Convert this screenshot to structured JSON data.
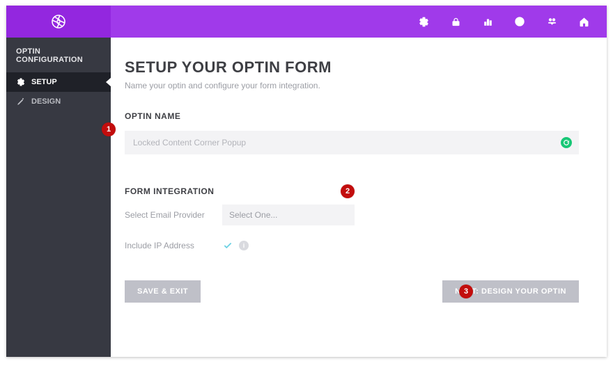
{
  "topbar": {
    "icons": [
      "gear-icon",
      "lock-icon",
      "bar-chart-icon",
      "user-circle-icon",
      "users-icon",
      "home-icon"
    ]
  },
  "sidebar": {
    "title": "OPTIN CONFIGURATION",
    "items": [
      {
        "icon": "gear-icon",
        "label": "SETUP",
        "active": true
      },
      {
        "icon": "pencil-icon",
        "label": "DESIGN",
        "active": false
      }
    ]
  },
  "page": {
    "heading": "SETUP YOUR OPTIN FORM",
    "subtitle": "Name your optin and configure your form integration."
  },
  "optin_name": {
    "label": "OPTIN NAME",
    "value": "Locked Content Corner Popup"
  },
  "form_integration": {
    "label": "FORM INTEGRATION",
    "provider_label": "Select Email Provider",
    "provider_placeholder": "Select One...",
    "ip_label": "Include IP Address",
    "ip_checked": true
  },
  "buttons": {
    "save_exit": "SAVE & EXIT",
    "next": "NEXT: DESIGN YOUR OPTIN"
  },
  "callouts": {
    "one": "1",
    "two": "2",
    "three": "3"
  }
}
